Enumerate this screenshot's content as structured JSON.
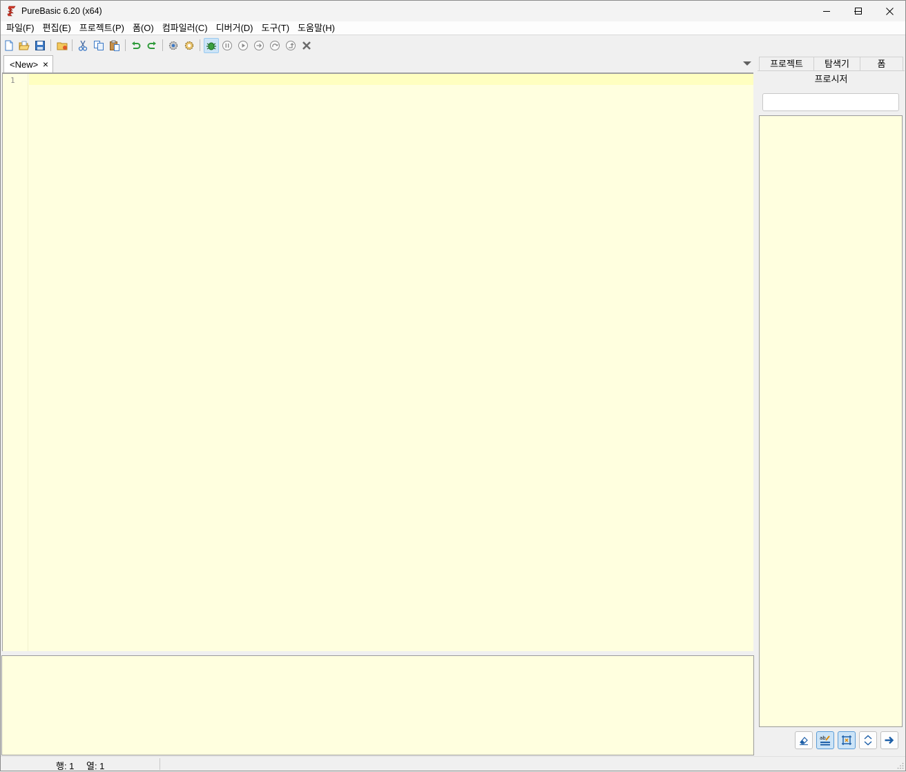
{
  "window": {
    "title": "PureBasic 6.20 (x64)",
    "controls": {
      "minimize": "minimize-icon",
      "maximize": "maximize-icon",
      "close": "close-icon"
    }
  },
  "menu": [
    {
      "name": "file",
      "label": "파일(F)"
    },
    {
      "name": "edit",
      "label": "편집(E)"
    },
    {
      "name": "project",
      "label": "프로젝트(P)"
    },
    {
      "name": "form",
      "label": "폼(O)"
    },
    {
      "name": "compiler",
      "label": "컴파일러(C)"
    },
    {
      "name": "debugger",
      "label": "디버거(D)"
    },
    {
      "name": "tools",
      "label": "도구(T)"
    },
    {
      "name": "help",
      "label": "도움말(H)"
    }
  ],
  "toolbar": {
    "icons": [
      "new-file-icon",
      "open-file-icon",
      "save-icon",
      "open-folder-icon",
      "cut-icon",
      "copy-icon",
      "paste-icon",
      "undo-icon",
      "redo-icon",
      "compile-run-icon",
      "build-icon",
      "debugger-icon",
      "stop-icon",
      "run-icon",
      "step-icon",
      "step-over-icon",
      "step-out-icon",
      "kill-icon"
    ],
    "debugger_active": true
  },
  "editor": {
    "tabs": [
      {
        "label": "<New>",
        "close": "×"
      }
    ],
    "line_numbers": [
      "1"
    ],
    "background": "#ffffdf",
    "current_line_color": "#ffffc0"
  },
  "side_panel": {
    "tabs": [
      "프로젝트",
      "탐색기",
      "폼"
    ],
    "title": "프로시저",
    "filter_value": "",
    "buttons": [
      "eraser-icon",
      "sort-alpha-icon",
      "group-icon",
      "expand-collapse-icon",
      "goto-arrow-icon"
    ]
  },
  "status": {
    "line": "행: 1",
    "column": "열: 1"
  }
}
